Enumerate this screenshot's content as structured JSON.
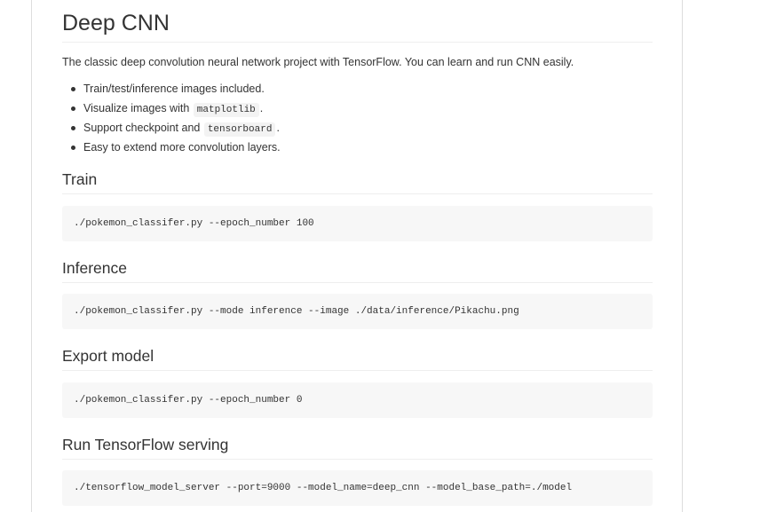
{
  "title": "Deep CNN",
  "intro": "The classic deep convolution neural network project with TensorFlow. You can learn and run CNN easily.",
  "features": [
    {
      "text": "Train/test/inference images included."
    },
    {
      "before": "Visualize images with",
      "code": "matplotlib",
      "after": "."
    },
    {
      "before": "Support checkpoint and",
      "code": "tensorboard",
      "after": "."
    },
    {
      "text": "Easy to extend more convolution layers."
    }
  ],
  "sections": [
    {
      "heading": "Train",
      "command": "./pokemon_classifer.py --epoch_number 100"
    },
    {
      "heading": "Inference",
      "command": "./pokemon_classifer.py --mode inference --image ./data/inference/Pikachu.png"
    },
    {
      "heading": "Export model",
      "command": "./pokemon_classifer.py --epoch_number 0"
    },
    {
      "heading": "Run TensorFlow serving",
      "command": "./tensorflow_model_server --port=9000 --model_name=deep_cnn --model_base_path=./model"
    }
  ]
}
